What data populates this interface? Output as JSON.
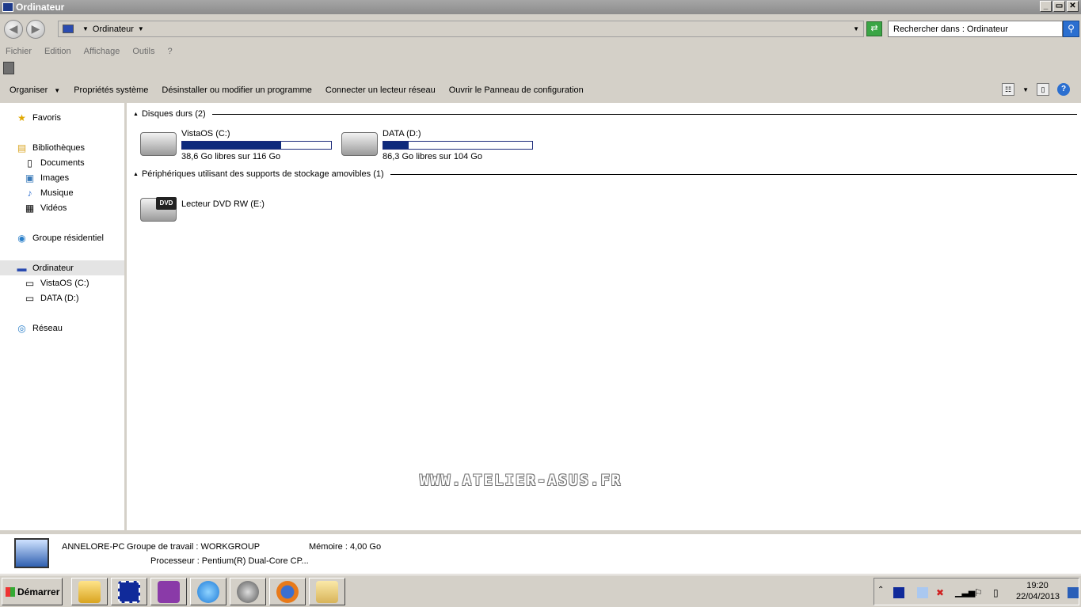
{
  "window": {
    "title": "Ordinateur"
  },
  "address": {
    "location": "Ordinateur",
    "search_placeholder": "Rechercher dans : Ordinateur"
  },
  "menu": [
    "Fichier",
    "Edition",
    "Affichage",
    "Outils",
    "?"
  ],
  "commands": {
    "organize": "Organiser",
    "system_properties": "Propriétés système",
    "uninstall": "Désinstaller ou modifier un programme",
    "map_drive": "Connecter un lecteur réseau",
    "control_panel": "Ouvrir le Panneau de configuration"
  },
  "nav": {
    "favorites": "Favoris",
    "libraries": "Bibliothèques",
    "documents": "Documents",
    "images": "Images",
    "music": "Musique",
    "videos": "Vidéos",
    "homegroup": "Groupe résidentiel",
    "computer": "Ordinateur",
    "drive_c": "VistaOS (C:)",
    "drive_d": "DATA (D:)",
    "network": "Réseau"
  },
  "groups": {
    "hard_disks": "Disques durs (2)",
    "removable": "Périphériques utilisant des supports de stockage amovibles (1)"
  },
  "drives": [
    {
      "name": "VistaOS (C:)",
      "free": "38,6 Go libres sur 116 Go",
      "used_fraction": 0.667
    },
    {
      "name": "DATA (D:)",
      "free": "86,3 Go libres sur 104 Go",
      "used_fraction": 0.17
    }
  ],
  "dvd": {
    "name": "Lecteur DVD RW (E:)",
    "badge": "DVD"
  },
  "watermark": "WWW.ATELIER-ASUS.FR",
  "details": {
    "pc_name": "ANNELORE-PC",
    "workgroup": "Groupe de travail : WORKGROUP",
    "memory": "Mémoire : 4,00 Go",
    "processor": "Processeur : Pentium(R) Dual-Core CP..."
  },
  "taskbar": {
    "start": "Démarrer",
    "time": "19:20",
    "date": "22/04/2013"
  }
}
